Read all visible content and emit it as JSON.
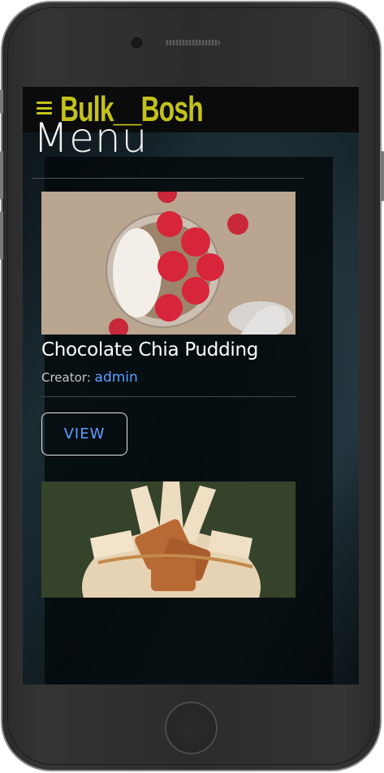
{
  "navbar": {
    "brand": "Bulk__Bosh",
    "menu_icon": "hamburger-menu-icon",
    "accent_color": "#c4c21b"
  },
  "page": {
    "title": "Menu"
  },
  "recipes": [
    {
      "title": "Chocolate Chia Pudding",
      "creator_label": "Creator:",
      "creator_name": "admin",
      "view_label": "VIEW",
      "image": "chia-pudding-with-raspberries-and-coconut"
    },
    {
      "image": "dessert-with-caramel-biscuits"
    }
  ],
  "colors": {
    "link": "#5aa0ff",
    "background": "#0c1418"
  }
}
